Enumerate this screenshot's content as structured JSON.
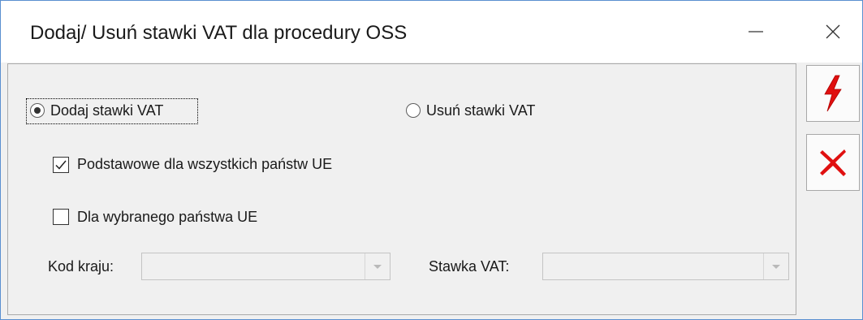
{
  "window": {
    "title": "Dodaj/ Usuń stawki VAT dla procedury OSS"
  },
  "mode": {
    "add_label": "Dodaj stawki VAT",
    "remove_label": "Usuń stawki VAT",
    "selected": "add"
  },
  "options": {
    "all_states_label": "Podstawowe dla wszystkich państw UE",
    "all_states_checked": true,
    "selected_state_label": "Dla wybranego państwa UE",
    "selected_state_checked": false
  },
  "fields": {
    "country_code_label": "Kod kraju:",
    "country_code_value": "",
    "vat_rate_label": "Stawka VAT:",
    "vat_rate_value": ""
  },
  "icons": {
    "run": "lightning-icon",
    "cancel": "cancel-x-icon",
    "accent_red": "#e01010"
  }
}
